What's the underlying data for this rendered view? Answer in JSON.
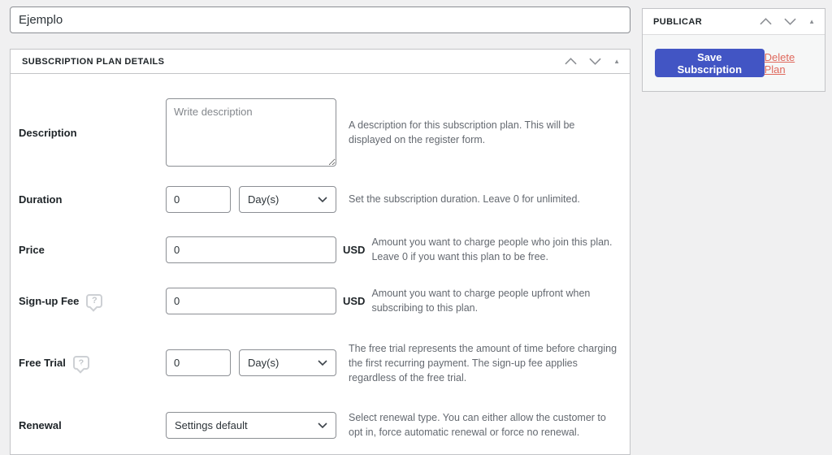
{
  "colors": {
    "page_background": "#f0f0f1",
    "box_border": "#c3c4c7",
    "input_border": "#8c8f94",
    "save_button_bg": "#4255c4",
    "delete_link": "#df685c",
    "help_text": "#646970"
  },
  "title_field": {
    "value": "Ejemplo"
  },
  "metabox": {
    "title": "SUBSCRIPTION PLAN DETAILS",
    "rows": [
      {
        "label": "Description",
        "placeholder": "Write description",
        "help": "A description for this subscription plan. This will be displayed on the register form."
      },
      {
        "label": "Duration",
        "value": "0",
        "unit_select": "Day(s)",
        "help": "Set the subscription duration. Leave 0 for unlimited."
      },
      {
        "label": "Price",
        "value": "0",
        "currency": "USD",
        "help": "Amount you want to charge people who join this plan. Leave 0 if you want this plan to be free."
      },
      {
        "label": "Sign-up Fee",
        "value": "0",
        "currency": "USD",
        "help": "Amount you want to charge people upfront when subscribing to this plan."
      },
      {
        "label": "Free Trial",
        "value": "0",
        "unit_select": "Day(s)",
        "help": "The free trial represents the amount of time before charging the first recurring payment. The sign-up fee applies regardless of the free trial."
      },
      {
        "label": "Renewal",
        "select_value": "Settings default",
        "help": "Select renewal type. You can either allow the customer to opt in, force automatic renewal or force no renewal."
      }
    ]
  },
  "publish_box": {
    "title": "PUBLICAR",
    "save_button_label": "Save Subscription",
    "delete_link_label": "Delete Plan"
  },
  "icons": {
    "help_question": "?",
    "collapse_triangle": "▲"
  }
}
